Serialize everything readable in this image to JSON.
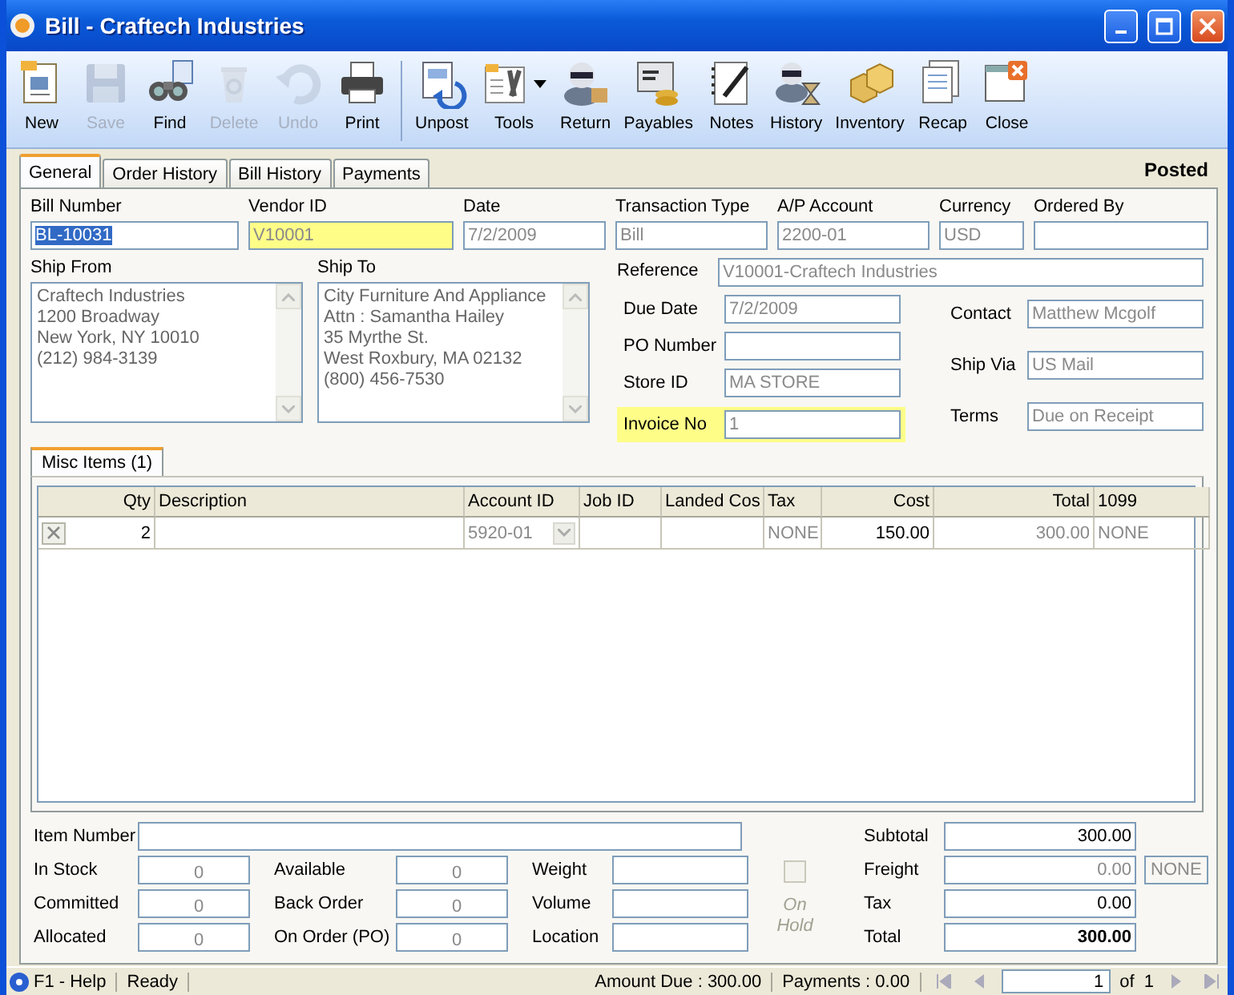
{
  "window": {
    "title": "Bill - Craftech Industries"
  },
  "toolbar_groups": [
    [
      {
        "label": "New",
        "disabled": false,
        "dropdown": false
      },
      {
        "label": "Save",
        "disabled": true,
        "dropdown": false
      },
      {
        "label": "Find",
        "disabled": false,
        "dropdown": false
      },
      {
        "label": "Delete",
        "disabled": true,
        "dropdown": false
      },
      {
        "label": "Undo",
        "disabled": true,
        "dropdown": false
      },
      {
        "label": "Print",
        "disabled": false,
        "dropdown": false
      }
    ],
    [
      {
        "label": "Unpost",
        "disabled": false,
        "dropdown": false
      },
      {
        "label": "Tools",
        "disabled": false,
        "dropdown": true
      },
      {
        "label": "Return",
        "disabled": false,
        "dropdown": false
      },
      {
        "label": "Payables",
        "disabled": false,
        "dropdown": false
      },
      {
        "label": "Notes",
        "disabled": false,
        "dropdown": false
      },
      {
        "label": "History",
        "disabled": false,
        "dropdown": false
      },
      {
        "label": "Inventory",
        "disabled": false,
        "dropdown": false
      },
      {
        "label": "Recap",
        "disabled": false,
        "dropdown": false
      },
      {
        "label": "Close",
        "disabled": false,
        "dropdown": false
      }
    ]
  ],
  "tabs": [
    {
      "label": "General",
      "selected": true
    },
    {
      "label": "Order History",
      "selected": false
    },
    {
      "label": "Bill History",
      "selected": false
    },
    {
      "label": "Payments",
      "selected": false
    }
  ],
  "status": "Posted",
  "header_fields": [
    {
      "label": "Bill Number",
      "value": "BL-10031",
      "readonly": false,
      "highlighted": false,
      "text_selected": true
    },
    {
      "label": "Vendor ID",
      "value": "V10001",
      "readonly": true,
      "highlighted": true,
      "text_selected": false
    },
    {
      "label": "Date",
      "value": "7/2/2009",
      "readonly": true,
      "highlighted": false,
      "text_selected": false
    },
    {
      "label": "Transaction Type",
      "value": "Bill",
      "readonly": true,
      "highlighted": false,
      "text_selected": false
    },
    {
      "label": "A/P Account",
      "value": "2200-01",
      "readonly": true,
      "highlighted": false,
      "text_selected": false
    },
    {
      "label": "Currency",
      "value": "USD",
      "readonly": true,
      "highlighted": false,
      "text_selected": false
    },
    {
      "label": "Ordered By",
      "highlighted": false
    }
  ],
  "ship_from": {
    "label": "Ship From",
    "lines": [
      "Craftech Industries",
      "1200 Broadway",
      "New York, NY 10010",
      "(212) 984-3139"
    ]
  },
  "ship_to": {
    "label": "Ship To",
    "lines": [
      "City Furniture And Appliance",
      "Attn : Samantha Hailey",
      "35 Myrthe St.",
      "West Roxbury, MA 02132",
      "(800) 456-7530"
    ]
  },
  "reference": {
    "label": "Reference",
    "value": "V10001-Craftech Industries",
    "readonly": true
  },
  "details_left": [
    {
      "label": "Due Date",
      "value": "7/2/2009",
      "readonly": true,
      "highlighted": false
    },
    {
      "label": "PO Number",
      "highlighted": false
    },
    {
      "label": "Store ID",
      "value": "MA STORE",
      "readonly": true,
      "highlighted": false
    },
    {
      "label": "Invoice No",
      "value": "1",
      "readonly": true,
      "highlighted": true
    }
  ],
  "details_right": [
    {
      "label": "Contact",
      "value": "Matthew Mcgolf",
      "readonly": true
    },
    {
      "label": "Ship Via",
      "value": "US Mail",
      "readonly": true
    },
    {
      "label": "Terms",
      "value": "Due on Receipt",
      "readonly": true
    }
  ],
  "items_tab": {
    "label": "Misc Items (1)",
    "selected": true
  },
  "table": {
    "columns": [
      {
        "label": "Qty",
        "readonly": false
      },
      {
        "label": "Description"
      },
      {
        "label": "Account ID",
        "readonly": true
      },
      {
        "label": "Job ID"
      },
      {
        "label": "Landed Cos"
      },
      {
        "label": "Tax",
        "readonly": true
      },
      {
        "label": "Cost",
        "readonly": false
      },
      {
        "label": "Total",
        "readonly": true
      },
      {
        "label": "1099",
        "readonly": true
      }
    ],
    "rows": [
      {
        "cells": {
          "qty": "2",
          "account_id": "5920-01",
          "tax": "NONE",
          "cost": "150.00",
          "total": "300.00",
          "col_1099": "NONE"
        }
      }
    ]
  },
  "item_number": {
    "label": "Item Number"
  },
  "stock_fields": [
    [
      {
        "label": "In Stock",
        "value": "0",
        "readonly": true
      },
      {
        "label": "Committed",
        "value": "0",
        "readonly": true
      },
      {
        "label": "Allocated",
        "value": "0",
        "readonly": true
      }
    ],
    [
      {
        "label": "Available",
        "value": "0",
        "readonly": true
      },
      {
        "label": "Back Order",
        "value": "0",
        "readonly": true
      },
      {
        "label": "On Order (PO)",
        "value": "0",
        "readonly": true
      }
    ],
    [
      {
        "label": "Weight"
      },
      {
        "label": "Volume"
      },
      {
        "label": "Location"
      }
    ]
  ],
  "on_hold": {
    "label": "On Hold",
    "checked": false,
    "disabled": true
  },
  "totals": [
    {
      "label": "Subtotal",
      "value": "300.00",
      "readonly": false,
      "kind": "amount"
    },
    {
      "label": "Freight",
      "value": "0.00",
      "readonly": true,
      "kind": "amount",
      "button": "NONE"
    },
    {
      "label": "Tax",
      "value": "0.00",
      "readonly": false,
      "kind": "amount"
    },
    {
      "label": "Total",
      "value": "300.00",
      "readonly": false,
      "kind": "total"
    }
  ],
  "status_bar": {
    "help": "F1 - Help",
    "message": "Ready",
    "amount_due": "Amount Due : 300.00",
    "payments": "Payments : 0.00",
    "page": "1",
    "page_total": "of  1"
  }
}
